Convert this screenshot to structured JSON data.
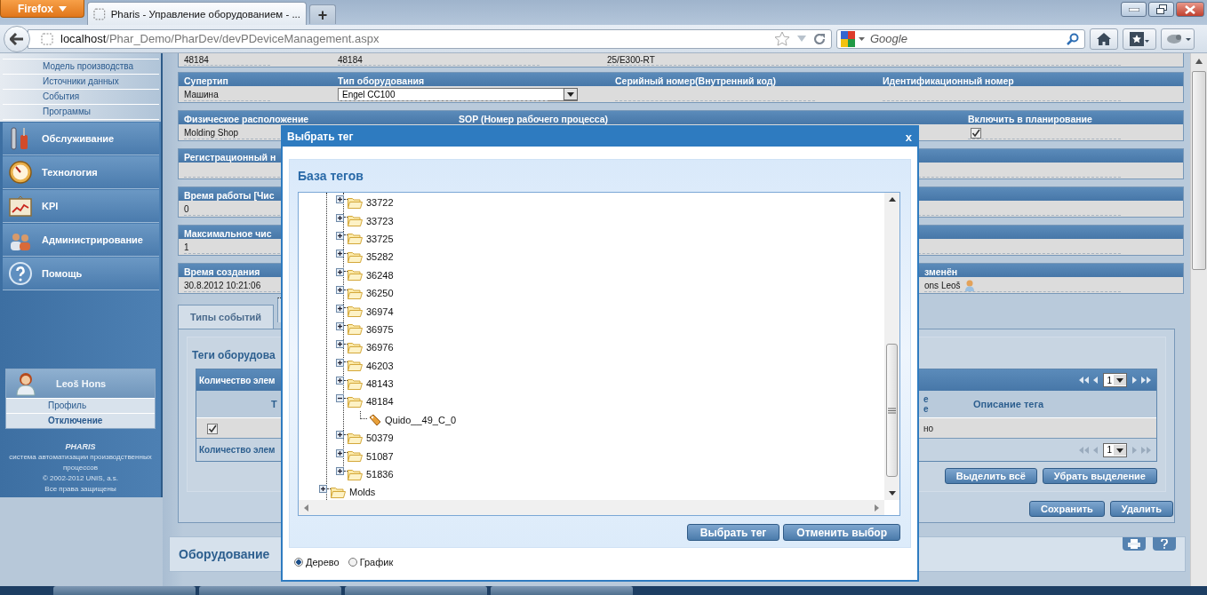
{
  "browser": {
    "menu_button": "Firefox",
    "tab_title": "Pharis - Управление оборудованием - ...",
    "new_tab": "+",
    "url_host": "localhost",
    "url_path": "/Phar_Demo/PharDev/devPDeviceManagement.aspx",
    "search_placeholder": "Google"
  },
  "sidebar": {
    "submenu": [
      "Модель производства",
      "Источники данных",
      "События",
      "Программы"
    ],
    "menu": [
      "Обслуживание",
      "Технология",
      "KPI",
      "Администрирование",
      "Помощь"
    ],
    "user": {
      "name": "Leoš  Hons",
      "links": [
        "Профиль",
        "Отключение"
      ]
    },
    "footer": {
      "logo": "PHARIS",
      "lines": [
        "система автоматизации производственных процессов",
        "© 2002-2012 UNIS, a.s.",
        "Все права защищены"
      ]
    }
  },
  "form": {
    "rows": [
      {
        "kind": "cut",
        "fields": [
          {
            "value": "48184"
          },
          {
            "value": "48184"
          },
          {
            "value": "25/E300-RT"
          }
        ]
      },
      {
        "kind": "quad",
        "fields": [
          {
            "label": "Супертип",
            "value": "Машина"
          },
          {
            "label": "Тип оборудования",
            "value": "Engel CC100",
            "kind": "select"
          },
          {
            "label": "Серийный номер(Внутренний код)"
          },
          {
            "label": "Идентификационный номер"
          }
        ]
      },
      {
        "kind": "triple",
        "fields": [
          {
            "label": "Физическое расположение",
            "value": "Molding Shop"
          },
          {
            "label": "SOP (Номер рабочего процесса)"
          },
          {
            "label": "Включить в планирование",
            "kind": "checkbox",
            "checked": true
          }
        ]
      },
      {
        "kind": "single",
        "fields": [
          {
            "label": "Регистрационный н"
          }
        ]
      },
      {
        "kind": "single",
        "fields": [
          {
            "label": "Время работы [Чис",
            "value": "0"
          }
        ]
      },
      {
        "kind": "single",
        "fields": [
          {
            "label": "Максимальное чис",
            "value": "1"
          }
        ]
      },
      {
        "kind": "pair",
        "fields": [
          {
            "label": "Время создания",
            "value": "30.8.2012 10:21:06"
          },
          {
            "label": "зменён",
            "value": "ons Leoš",
            "kind": "user"
          }
        ]
      }
    ]
  },
  "tabs": [
    {
      "label": "Типы событий",
      "selected": false
    }
  ],
  "tags_panel": {
    "title": "Теги оборудова",
    "header": "Количество элем",
    "page": "1",
    "columns": [
      "Т",
      "е\nе",
      "Описание тега"
    ],
    "rows": [
      {
        "checked": true,
        "cell": "но"
      }
    ],
    "footer": "Количество элем",
    "footer_page": "1",
    "buttons": [
      "Выделить всё",
      "Убрать выделение"
    ]
  },
  "actions": [
    "Сохранить",
    "Удалить"
  ],
  "section_title": "Оборудование",
  "dialog": {
    "title": "Выбрать тег",
    "close": "x",
    "heading": "База тегов",
    "tree": [
      {
        "kind": "folder",
        "children": [
          {
            "kind": "folder",
            "label": "33722",
            "expanded": false
          },
          {
            "kind": "folder",
            "label": "33723",
            "expanded": false
          },
          {
            "kind": "folder",
            "label": "33725",
            "expanded": false
          },
          {
            "kind": "folder",
            "label": "35282",
            "expanded": false
          },
          {
            "kind": "folder",
            "label": "36248",
            "expanded": false
          },
          {
            "kind": "folder",
            "label": "36250",
            "expanded": false
          },
          {
            "kind": "folder",
            "label": "36974",
            "expanded": false
          },
          {
            "kind": "folder",
            "label": "36975",
            "expanded": false
          },
          {
            "kind": "folder",
            "label": "36976",
            "expanded": false
          },
          {
            "kind": "folder",
            "label": "46203",
            "expanded": false
          },
          {
            "kind": "folder",
            "label": "48143",
            "expanded": false
          },
          {
            "kind": "folder",
            "label": "48184",
            "expanded": true,
            "children": [
              {
                "kind": "tag",
                "label": "Quido__49_C_0"
              }
            ]
          },
          {
            "kind": "folder",
            "label": "50379",
            "expanded": false
          },
          {
            "kind": "folder",
            "label": "51087",
            "expanded": false
          },
          {
            "kind": "folder",
            "label": "51836",
            "expanded": false
          }
        ]
      },
      {
        "kind": "folder",
        "label": "Molds",
        "expanded": false
      }
    ],
    "buttons": [
      "Выбрать тег",
      "Отменить выбор"
    ],
    "views": [
      {
        "label": "Дерево",
        "selected": true
      },
      {
        "label": "График",
        "selected": false
      }
    ]
  }
}
